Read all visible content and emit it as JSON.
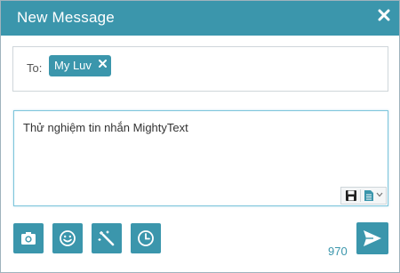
{
  "dialog": {
    "title": "New Message"
  },
  "recipients": {
    "label": "To:",
    "chips": [
      {
        "name": "My Luv"
      }
    ]
  },
  "message": {
    "text": "Thử nghiệm tin nhắn MightyText"
  },
  "char_counter": "970",
  "icons": {
    "close": "close-icon",
    "save": "save-icon",
    "template": "document-icon",
    "camera": "camera-icon",
    "emoji": "smiley-icon",
    "magic": "magic-wand-icon",
    "schedule": "clock-icon",
    "send": "send-icon"
  },
  "colors": {
    "accent": "#3b96ac",
    "border": "#cfd6da",
    "focus_border": "#7ec5dc"
  }
}
